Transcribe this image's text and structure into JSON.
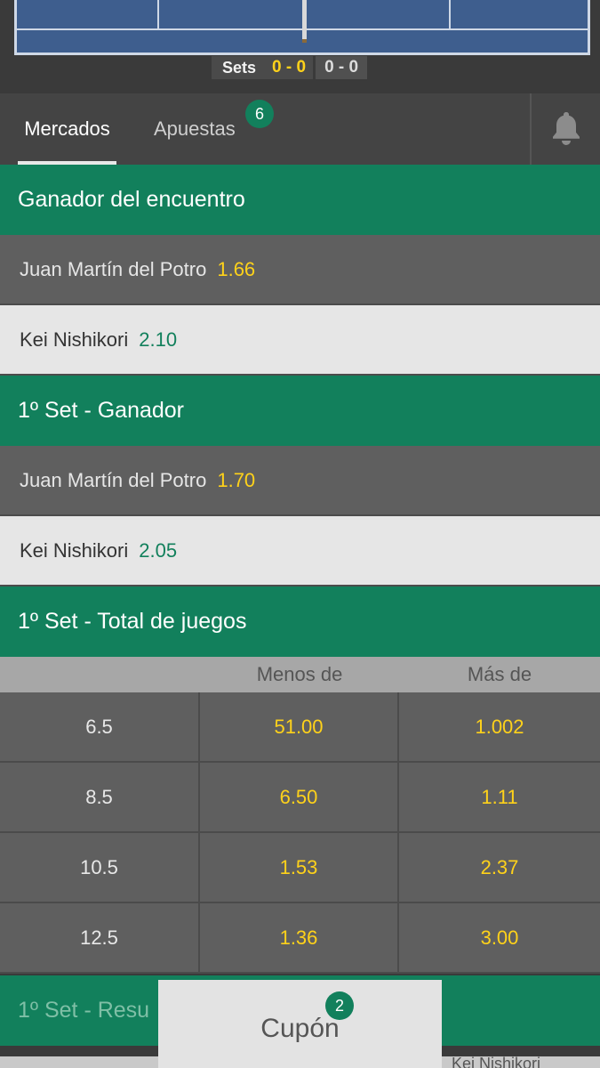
{
  "score": {
    "label": "Sets",
    "current": "0 - 0",
    "previous": "0 - 0"
  },
  "tabs": {
    "markets": "Mercados",
    "bets": "Apuestas",
    "bets_count": "6"
  },
  "icons": {
    "bell": "bell-icon"
  },
  "colors": {
    "green": "#12805c",
    "yellow_odds": "#ffd21a"
  },
  "markets": [
    {
      "title": "Ganador del encuentro",
      "selections": [
        {
          "name": "Juan Martín del Potro",
          "odds": "1.66"
        },
        {
          "name": "Kei Nishikori",
          "odds": "2.10"
        }
      ]
    },
    {
      "title": "1º Set - Ganador",
      "selections": [
        {
          "name": "Juan Martín del Potro",
          "odds": "1.70"
        },
        {
          "name": "Kei Nishikori",
          "odds": "2.05"
        }
      ]
    },
    {
      "title": "1º Set - Total de juegos",
      "columns": [
        "",
        "Menos de",
        "Más de"
      ],
      "rows": [
        {
          "line": "6.5",
          "under": "51.00",
          "over": "1.002"
        },
        {
          "line": "8.5",
          "under": "6.50",
          "over": "1.11"
        },
        {
          "line": "10.5",
          "under": "1.53",
          "over": "2.37"
        },
        {
          "line": "12.5",
          "under": "1.36",
          "over": "3.00"
        }
      ]
    },
    {
      "title": "1º Set - Resu"
    }
  ],
  "bottom_partial": "Kei Nishikori",
  "coupon": {
    "label": "Cupón",
    "count": "2"
  }
}
